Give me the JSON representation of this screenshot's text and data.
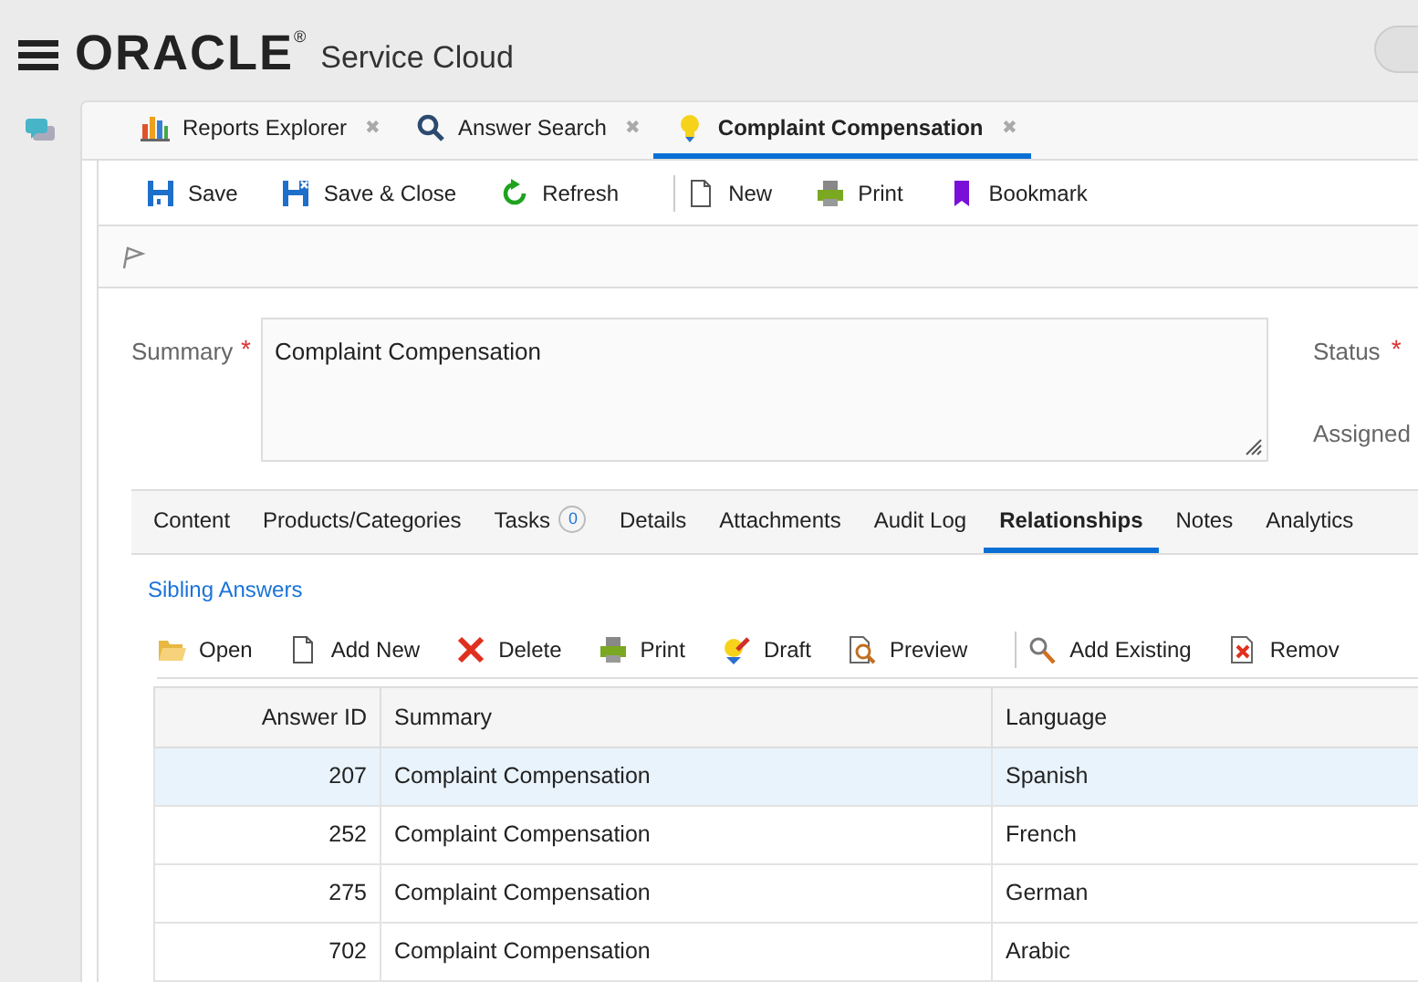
{
  "header": {
    "logo": "ORACLE",
    "logo_mark": "®",
    "product": "Service Cloud"
  },
  "workspace_tabs": [
    {
      "label": "Reports Explorer",
      "close": "✖",
      "selected": false
    },
    {
      "label": "Answer Search",
      "close": "✖",
      "selected": false
    },
    {
      "label": "Complaint Compensation",
      "close": "✖",
      "selected": true
    }
  ],
  "toolbar": [
    {
      "kind": "button",
      "label": "Save"
    },
    {
      "kind": "button",
      "label": "Save & Close"
    },
    {
      "kind": "button",
      "label": "Refresh"
    },
    {
      "kind": "divider"
    },
    {
      "kind": "button",
      "label": "New"
    },
    {
      "kind": "button",
      "label": "Print"
    },
    {
      "kind": "button",
      "label": "Bookmark"
    }
  ],
  "form": {
    "summary_label": "Summary",
    "required_mark": "*",
    "summary_value": "Complaint Compensation",
    "status_label": "Status",
    "status_required": "*",
    "assigned_label": "Assigned"
  },
  "content_tabs": [
    {
      "label": "Content",
      "selected": false
    },
    {
      "label": "Products/Categories",
      "selected": false
    },
    {
      "label": "Tasks",
      "count": "0",
      "selected": false
    },
    {
      "label": "Details",
      "selected": false
    },
    {
      "label": "Attachments",
      "selected": false
    },
    {
      "label": "Audit Log",
      "selected": false
    },
    {
      "label": "Relationships",
      "selected": true
    },
    {
      "label": "Notes",
      "selected": false
    },
    {
      "label": "Analytics",
      "selected": false
    }
  ],
  "section_link": "Sibling Answers",
  "list_toolbar": [
    {
      "kind": "button",
      "label": "Open"
    },
    {
      "kind": "button",
      "label": "Add New"
    },
    {
      "kind": "button",
      "label": "Delete"
    },
    {
      "kind": "button",
      "label": "Print"
    },
    {
      "kind": "button",
      "label": "Draft"
    },
    {
      "kind": "button",
      "label": "Preview"
    },
    {
      "kind": "divider"
    },
    {
      "kind": "button",
      "label": "Add Existing"
    },
    {
      "kind": "button",
      "label": "Remov"
    }
  ],
  "table": {
    "columns": [
      "Answer ID",
      "Summary",
      "Language"
    ],
    "rows": [
      {
        "cells": [
          "207",
          "Complaint Compensation",
          "Spanish"
        ],
        "selected": true
      },
      {
        "cells": [
          "252",
          "Complaint Compensation",
          "French"
        ],
        "selected": false
      },
      {
        "cells": [
          "275",
          "Complaint Compensation",
          "German"
        ],
        "selected": false
      },
      {
        "cells": [
          "702",
          "Complaint Compensation",
          "Arabic"
        ],
        "selected": false
      }
    ]
  }
}
